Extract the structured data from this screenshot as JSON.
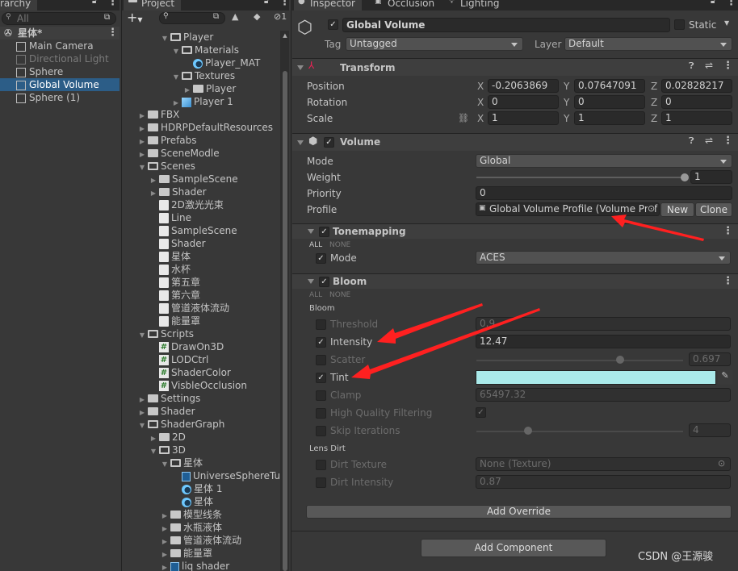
{
  "hierarchy": {
    "tab_label": "rarchy",
    "search_placeholder": "All",
    "scene": "星体*",
    "items": [
      {
        "label": "Main Camera",
        "state": "normal"
      },
      {
        "label": "Directional Light",
        "state": "disabled"
      },
      {
        "label": "Sphere",
        "state": "normal"
      },
      {
        "label": "Global Volume",
        "state": "selected"
      },
      {
        "label": "Sphere (1)",
        "state": "normal"
      }
    ]
  },
  "project": {
    "tab_label": "Project",
    "hidden_count": "1",
    "tree": [
      {
        "label": "Player",
        "level": 2,
        "type": "folder",
        "open": true
      },
      {
        "label": "Materials",
        "level": 3,
        "type": "folder",
        "open": true
      },
      {
        "label": "Player_MAT",
        "level": 4,
        "type": "material"
      },
      {
        "label": "Textures",
        "level": 3,
        "type": "folder",
        "open": true
      },
      {
        "label": "Player",
        "level": 4,
        "type": "folder",
        "open": false
      },
      {
        "label": "Player 1",
        "level": 3,
        "type": "prefab",
        "expandable": true
      },
      {
        "label": "FBX",
        "level": 0,
        "type": "folder",
        "open": false
      },
      {
        "label": "HDRPDefaultResources",
        "level": 0,
        "type": "folder",
        "open": false
      },
      {
        "label": "Prefabs",
        "level": 0,
        "type": "folder",
        "open": false
      },
      {
        "label": "SceneModle",
        "level": 0,
        "type": "folder",
        "open": false
      },
      {
        "label": "Scenes",
        "level": 0,
        "type": "folder",
        "open": true
      },
      {
        "label": "SampleScene",
        "level": 1,
        "type": "folder",
        "open": false
      },
      {
        "label": "Shader",
        "level": 1,
        "type": "folder",
        "open": false
      },
      {
        "label": "2D激光光束",
        "level": 1,
        "type": "scene"
      },
      {
        "label": "Line",
        "level": 1,
        "type": "scene"
      },
      {
        "label": "SampleScene",
        "level": 1,
        "type": "scene"
      },
      {
        "label": "Shader",
        "level": 1,
        "type": "scene"
      },
      {
        "label": "星体",
        "level": 1,
        "type": "scene"
      },
      {
        "label": "水杯",
        "level": 1,
        "type": "scene"
      },
      {
        "label": "第五章",
        "level": 1,
        "type": "scene"
      },
      {
        "label": "第六章",
        "level": 1,
        "type": "scene"
      },
      {
        "label": "管道液体流动",
        "level": 1,
        "type": "scene"
      },
      {
        "label": "能量罩",
        "level": 1,
        "type": "scene"
      },
      {
        "label": "Scripts",
        "level": 0,
        "type": "folder",
        "open": true
      },
      {
        "label": "DrawOn3D",
        "level": 1,
        "type": "script"
      },
      {
        "label": "LODCtrl",
        "level": 1,
        "type": "script"
      },
      {
        "label": "ShaderColor",
        "level": 1,
        "type": "script"
      },
      {
        "label": "VisbleOcclusion",
        "level": 1,
        "type": "script"
      },
      {
        "label": "Settings",
        "level": 0,
        "type": "folder",
        "open": false
      },
      {
        "label": "Shader",
        "level": 0,
        "type": "folder",
        "open": false
      },
      {
        "label": "ShaderGraph",
        "level": 0,
        "type": "folder",
        "open": true
      },
      {
        "label": "2D",
        "level": 1,
        "type": "folder",
        "open": false
      },
      {
        "label": "3D",
        "level": 1,
        "type": "folder",
        "open": true
      },
      {
        "label": "星体",
        "level": 2,
        "type": "folder",
        "open": true
      },
      {
        "label": "UniverseSphereTu",
        "level": 3,
        "type": "shadergraph"
      },
      {
        "label": "星体 1",
        "level": 3,
        "type": "material"
      },
      {
        "label": "星体",
        "level": 3,
        "type": "material"
      },
      {
        "label": "模型线条",
        "level": 2,
        "type": "folder",
        "open": false
      },
      {
        "label": "水瓶液体",
        "level": 2,
        "type": "folder",
        "open": false
      },
      {
        "label": "管道液体流动",
        "level": 2,
        "type": "folder",
        "open": false
      },
      {
        "label": "能量罩",
        "level": 2,
        "type": "folder",
        "open": false
      },
      {
        "label": "liq shader",
        "level": 2,
        "type": "other",
        "expandable": true
      }
    ]
  },
  "inspector": {
    "tabs": [
      "Inspector",
      "Occlusion",
      "Lighting"
    ],
    "object": {
      "name": "Global Volume",
      "active": true,
      "static_label": "Static",
      "tag_label": "Tag",
      "tag": "Untagged",
      "layer_label": "Layer",
      "layer": "Default"
    },
    "transform": {
      "title": "Transform",
      "rows": [
        {
          "label": "Position",
          "x": "-0.2063869",
          "y": "0.07647091",
          "z": "0.02828217"
        },
        {
          "label": "Rotation",
          "x": "0",
          "y": "0",
          "z": "0"
        },
        {
          "label": "Scale",
          "x": "1",
          "y": "1",
          "z": "1"
        }
      ],
      "axis": [
        "X",
        "Y",
        "Z"
      ]
    },
    "volume": {
      "title": "Volume",
      "mode_label": "Mode",
      "mode": "Global",
      "weight_label": "Weight",
      "weight": "1",
      "weight_fraction": 1.0,
      "priority_label": "Priority",
      "priority": "0",
      "profile_label": "Profile",
      "profile": "Global Volume Profile (Volume Prof",
      "new_label": "New",
      "clone_label": "Clone"
    },
    "tonemapping": {
      "title": "Tonemapping",
      "all": "ALL",
      "none": "NONE",
      "mode_label": "Mode",
      "mode": "ACES"
    },
    "bloom": {
      "title": "Bloom",
      "all": "ALL",
      "none": "NONE",
      "section_bloom": "Bloom",
      "threshold": {
        "label": "Threshold",
        "value": "0.9",
        "enabled": false
      },
      "intensity": {
        "label": "Intensity",
        "value": "12.47",
        "enabled": true
      },
      "scatter": {
        "label": "Scatter",
        "value": "0.697",
        "enabled": false,
        "fraction": 0.697
      },
      "tint": {
        "label": "Tint",
        "enabled": true,
        "color": "#aaeaea"
      },
      "clamp": {
        "label": "Clamp",
        "value": "65497.32",
        "enabled": false
      },
      "hq": {
        "label": "High Quality Filtering",
        "enabled": false,
        "checked": true
      },
      "skip": {
        "label": "Skip Iterations",
        "value": "4",
        "enabled": false,
        "fraction": 0.25
      },
      "section_lens": "Lens Dirt",
      "dirt_texture": {
        "label": "Dirt Texture",
        "value": "None (Texture)",
        "enabled": false
      },
      "dirt_intensity": {
        "label": "Dirt Intensity",
        "value": "0.87",
        "enabled": false
      }
    },
    "add_override": "Add Override",
    "add_component": "Add Component"
  },
  "watermark": "CSDN @王源骏",
  "colors": {
    "selection": "#2c5d87",
    "annotation_arrow": "#ff2020",
    "tint": "#aaeaea"
  }
}
